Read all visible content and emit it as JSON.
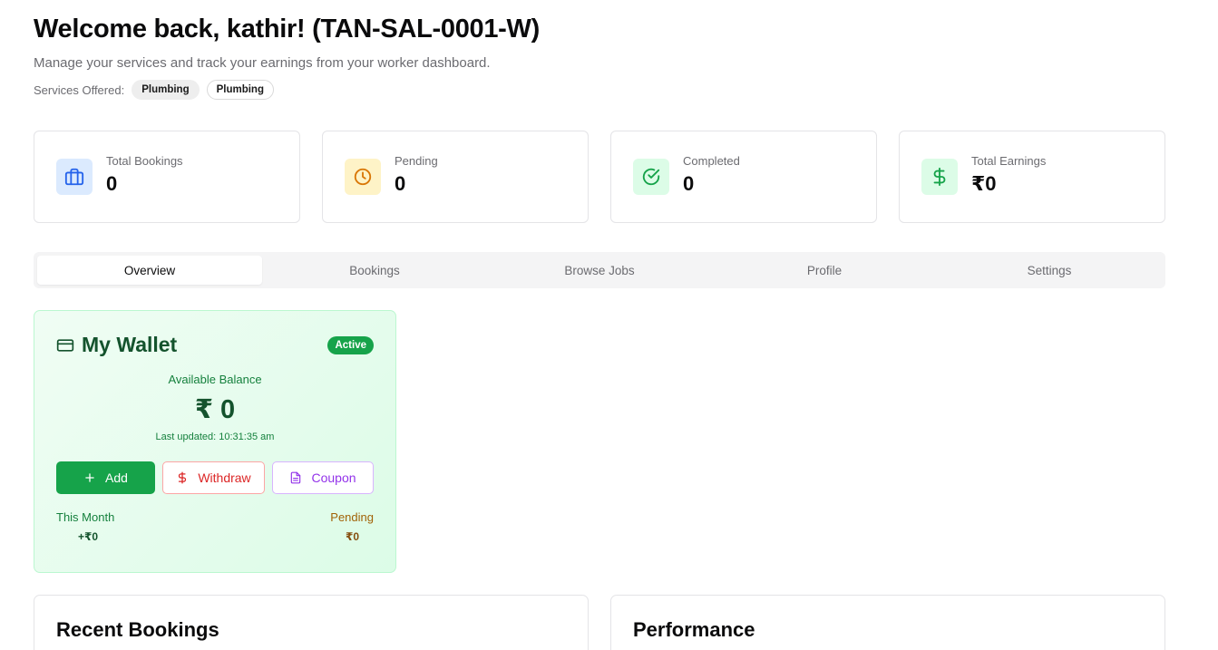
{
  "header": {
    "title": "Welcome back, kathir! (TAN-SAL-0001-W)",
    "subtitle": "Manage your services and track your earnings from your worker dashboard.",
    "services_label": "Services Offered:",
    "services": [
      "Plumbing",
      "Plumbing"
    ]
  },
  "stats": [
    {
      "label": "Total Bookings",
      "value": "0",
      "icon": "briefcase-icon",
      "color": "#2563eb"
    },
    {
      "label": "Pending",
      "value": "0",
      "icon": "clock-icon",
      "color": "#d97706"
    },
    {
      "label": "Completed",
      "value": "0",
      "icon": "check-circle-icon",
      "color": "#16a34a"
    },
    {
      "label": "Total Earnings",
      "value": "₹0",
      "icon": "dollar-icon",
      "color": "#16a34a"
    }
  ],
  "tabs": [
    {
      "label": "Overview",
      "active": true
    },
    {
      "label": "Bookings",
      "active": false
    },
    {
      "label": "Browse Jobs",
      "active": false
    },
    {
      "label": "Profile",
      "active": false
    },
    {
      "label": "Settings",
      "active": false
    }
  ],
  "wallet": {
    "title": "My Wallet",
    "status": "Active",
    "balance_label": "Available Balance",
    "balance": "₹ 0",
    "last_updated": "Last updated: 10:31:35 am",
    "actions": {
      "add": "Add",
      "withdraw": "Withdraw",
      "coupon": "Coupon"
    },
    "this_month_label": "This Month",
    "this_month_value": "+₹0",
    "pending_label": "Pending",
    "pending_value": "₹0"
  },
  "panels": {
    "recent_bookings_title": "Recent Bookings",
    "performance_title": "Performance"
  },
  "colors": {
    "accent_green": "#16a34a",
    "withdraw_red": "#dc2626",
    "coupon_purple": "#9333ea"
  }
}
